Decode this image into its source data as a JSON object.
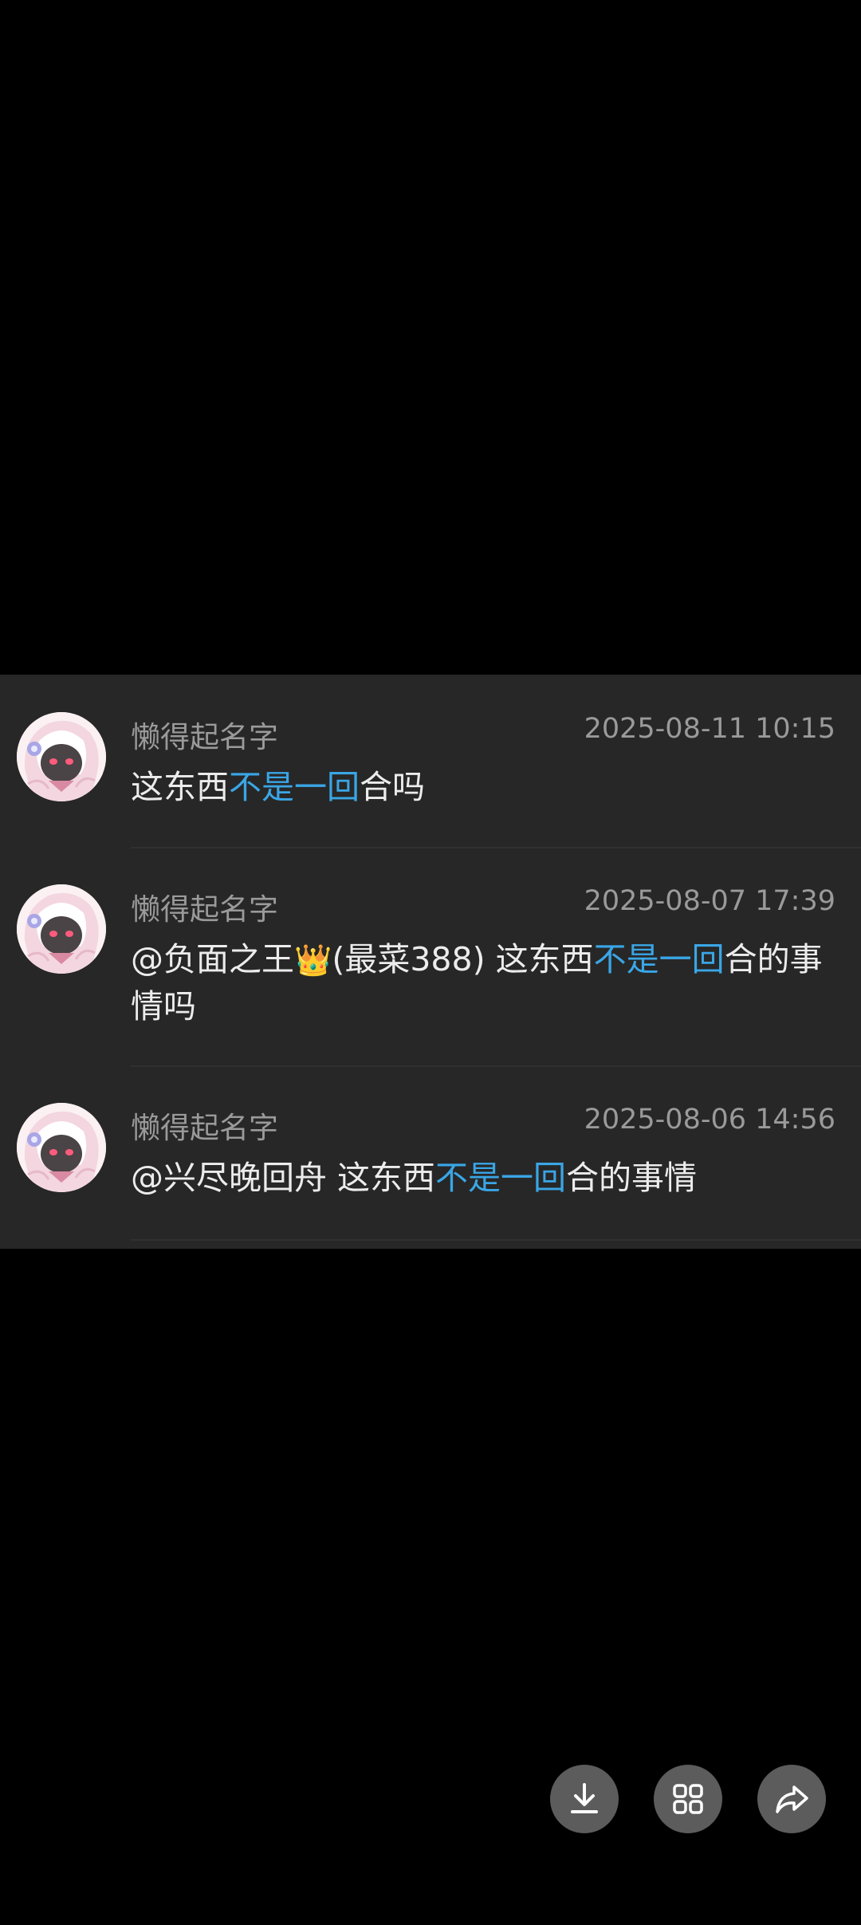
{
  "comments": [
    {
      "username": "懒得起名字",
      "time": "2025-08-11 10:15",
      "text_pre": "这东西",
      "keyword": "不是一回",
      "text_post": "合吗"
    },
    {
      "username": "懒得起名字",
      "time": "2025-08-07 17:39",
      "mention": "@负面之王",
      "mention_badge": "👑",
      "mention_suffix": "(最菜388)",
      "text_pre": " 这东西",
      "keyword": "不是一回",
      "text_post": "合的事情吗"
    },
    {
      "username": "懒得起名字",
      "time": "2025-08-06 14:56",
      "mention": "@兴尽晚回舟",
      "text_pre": " 这东西",
      "keyword": "不是一回",
      "text_post": "合的事情"
    }
  ],
  "actions": {
    "download_icon": "download-icon",
    "grid_icon": "grid-icon",
    "share_icon": "share-icon"
  },
  "colors": {
    "background": "#000000",
    "panel": "#272727",
    "keyword_highlight": "#3aa6e6",
    "meta_text": "#9a9a9a",
    "button": "#5c5c5c"
  }
}
